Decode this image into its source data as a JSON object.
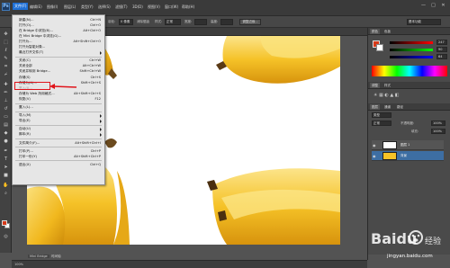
{
  "app": {
    "logo": "Ps"
  },
  "menubar": {
    "items": [
      {
        "label": "文件(F)",
        "active": true
      },
      {
        "label": "编辑(E)"
      },
      {
        "label": "图像(I)"
      },
      {
        "label": "图层(L)"
      },
      {
        "label": "类型(Y)"
      },
      {
        "label": "选择(S)"
      },
      {
        "label": "滤镜(T)"
      },
      {
        "label": "3D(D)"
      },
      {
        "label": "视图(V)"
      },
      {
        "label": "窗口(W)"
      },
      {
        "label": "帮助(H)"
      }
    ],
    "window_controls": [
      "—",
      "□",
      "✕"
    ]
  },
  "optbar": {
    "feather_label": "羽化:",
    "feather_value": "0 像素",
    "antialias_label": "消除锯齿",
    "style_label": "样式:",
    "style_value": "正常",
    "width_label": "宽度:",
    "height_label": "高度:",
    "refine_button": "调整边缘...",
    "workspace_value": "基本功能"
  },
  "file_menu": {
    "items": [
      {
        "label": "新建(N)...",
        "shortcut": "Ctrl+N"
      },
      {
        "label": "打开(O)...",
        "shortcut": "Ctrl+O"
      },
      {
        "label": "在 Bridge 中浏览(B)...",
        "shortcut": "Alt+Ctrl+O"
      },
      {
        "label": "在 Mini Bridge 中浏览(G)...",
        "shortcut": ""
      },
      {
        "label": "打开为...",
        "shortcut": "Alt+Shift+Ctrl+O"
      },
      {
        "label": "打开为智能对象...",
        "shortcut": ""
      },
      {
        "label": "最近打开文件(T)",
        "shortcut": "",
        "submenu": true
      },
      {
        "sep": true
      },
      {
        "label": "关闭(C)",
        "shortcut": "Ctrl+W"
      },
      {
        "label": "关闭全部",
        "shortcut": "Alt+Ctrl+W"
      },
      {
        "label": "关闭并转到 Bridge...",
        "shortcut": "Shift+Ctrl+W"
      },
      {
        "label": "存储(S)",
        "shortcut": "Ctrl+S"
      },
      {
        "label": "存储为(A)...",
        "shortcut": "Shift+Ctrl+S",
        "highlighted": true
      },
      {
        "label": "签入(I)...",
        "shortcut": "",
        "disabled": true
      },
      {
        "label": "存储为 Web 所用格式...",
        "shortcut": "Alt+Shift+Ctrl+S"
      },
      {
        "label": "恢复(V)",
        "shortcut": "F12"
      },
      {
        "sep": true
      },
      {
        "label": "置入(L)...",
        "shortcut": ""
      },
      {
        "sep": true
      },
      {
        "label": "导入(M)",
        "shortcut": "",
        "submenu": true
      },
      {
        "label": "导出(E)",
        "shortcut": "",
        "submenu": true
      },
      {
        "sep": true
      },
      {
        "label": "自动(U)",
        "shortcut": "",
        "submenu": true
      },
      {
        "label": "脚本(R)",
        "shortcut": "",
        "submenu": true
      },
      {
        "sep": true
      },
      {
        "label": "文件简介(F)...",
        "shortcut": "Alt+Shift+Ctrl+I"
      },
      {
        "sep": true
      },
      {
        "label": "打印(P)...",
        "shortcut": "Ctrl+P"
      },
      {
        "label": "打印一份(Y)",
        "shortcut": "Alt+Shift+Ctrl+P"
      },
      {
        "sep": true
      },
      {
        "label": "退出(X)",
        "shortcut": "Ctrl+Q"
      }
    ]
  },
  "statusbar": {
    "zoom": "100%",
    "bridge": "Mini Bridge",
    "timeline": "时间轴"
  },
  "right_panel": {
    "color_tabs": [
      "颜色",
      "色板"
    ],
    "adjust_tabs": [
      "调整",
      "样式"
    ],
    "layers_tabs": [
      "图层",
      "通道",
      "路径"
    ],
    "kind_label": "类型",
    "blend_mode": "正常",
    "opacity_label": "不透明度:",
    "opacity_value": "100%",
    "fill_label": "填充:",
    "fill_value": "100%",
    "layers": [
      {
        "name": "图层 1",
        "selected": false
      },
      {
        "name": "背景",
        "selected": true
      }
    ],
    "rgb_values": [
      "247",
      "90",
      "64"
    ]
  },
  "watermark": {
    "brand": "Baidu",
    "sub": "经验",
    "url": "jingyan.baidu.com"
  },
  "colors": {
    "menu_bg": "#e6e6e6",
    "highlight_red": "#e0141b",
    "active_menu": "#1f6fd4",
    "fg_swatch": "#d63a1a"
  }
}
